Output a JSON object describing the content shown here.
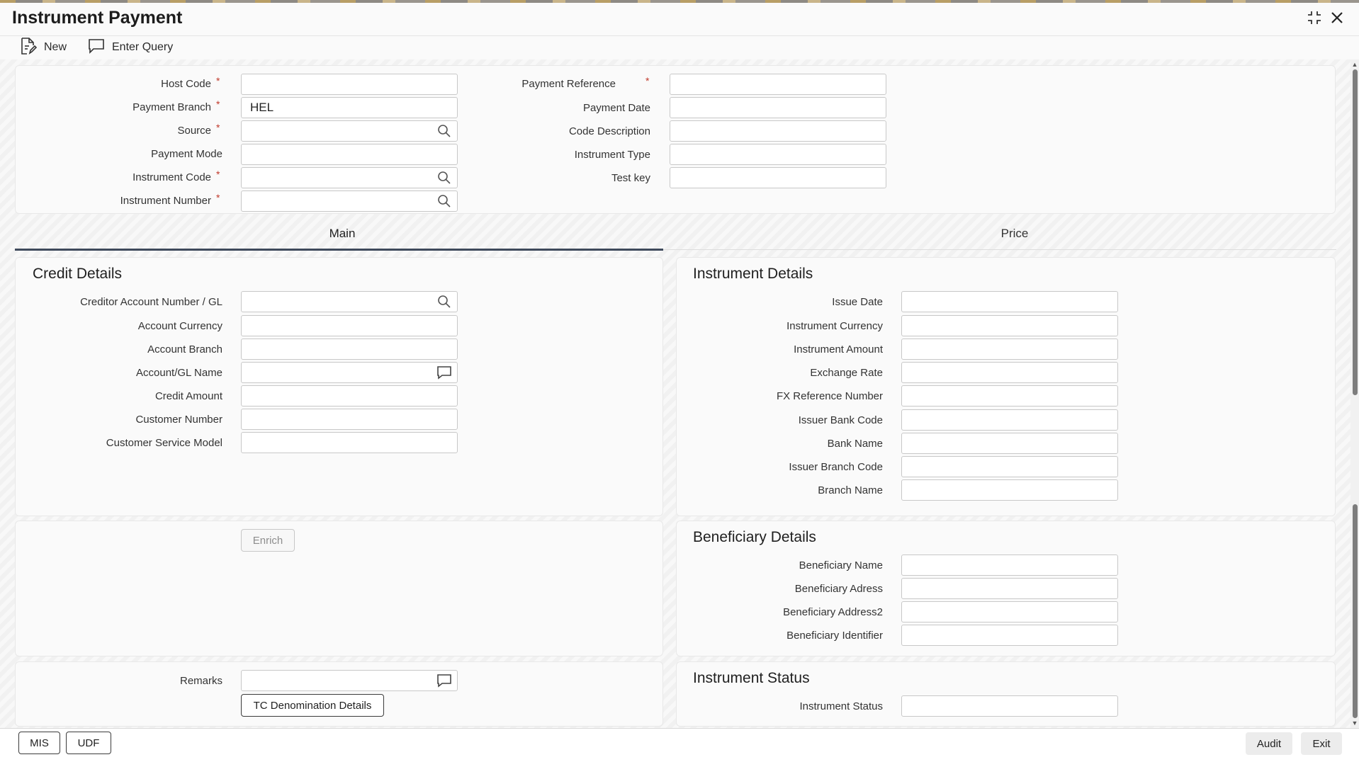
{
  "window": {
    "title": "Instrument Payment",
    "actions": {
      "maximize_icon": "maximize-icon",
      "close_icon": "close-icon"
    }
  },
  "toolbar": {
    "new_label": "New",
    "enter_query_label": "Enter Query"
  },
  "header_form": {
    "host_code": {
      "label": "Host Code",
      "required": "*",
      "value": ""
    },
    "payment_branch": {
      "label": "Payment Branch",
      "required": "*",
      "value": "HEL"
    },
    "source": {
      "label": "Source",
      "required": "*",
      "value": ""
    },
    "payment_mode": {
      "label": "Payment Mode",
      "value": ""
    },
    "instrument_code": {
      "label": "Instrument Code",
      "required": "*",
      "value": ""
    },
    "instrument_number": {
      "label": "Instrument Number",
      "required": "*",
      "value": ""
    },
    "payment_reference": {
      "label": "Payment Reference",
      "required": "*",
      "value": ""
    },
    "payment_date": {
      "label": "Payment Date",
      "value": ""
    },
    "code_description": {
      "label": "Code Description",
      "value": ""
    },
    "instrument_type": {
      "label": "Instrument Type",
      "value": ""
    },
    "test_key": {
      "label": "Test key",
      "value": ""
    }
  },
  "tabs": [
    {
      "label": "Main",
      "active": true
    },
    {
      "label": "Price",
      "active": false
    }
  ],
  "credit_details": {
    "title": "Credit Details",
    "creditor_account": {
      "label": "Creditor Account Number / GL",
      "value": ""
    },
    "account_currency": {
      "label": "Account Currency",
      "value": ""
    },
    "account_branch": {
      "label": "Account Branch",
      "value": ""
    },
    "account_gl_name": {
      "label": "Account/GL Name",
      "value": ""
    },
    "credit_amount": {
      "label": "Credit Amount",
      "value": ""
    },
    "customer_number": {
      "label": "Customer Number",
      "value": ""
    },
    "customer_service_model": {
      "label": "Customer Service Model",
      "value": ""
    }
  },
  "enrich_label": "Enrich",
  "remarks": {
    "label": "Remarks",
    "value": ""
  },
  "tc_denomination_label": "TC Denomination Details",
  "instrument_details": {
    "title": "Instrument Details",
    "issue_date": {
      "label": "Issue Date",
      "value": ""
    },
    "instrument_currency": {
      "label": "Instrument Currency",
      "value": ""
    },
    "instrument_amount": {
      "label": "Instrument Amount",
      "value": ""
    },
    "exchange_rate": {
      "label": "Exchange Rate",
      "value": ""
    },
    "fx_reference_number": {
      "label": "FX Reference Number",
      "value": ""
    },
    "issuer_bank_code": {
      "label": "Issuer Bank Code",
      "value": ""
    },
    "bank_name": {
      "label": "Bank Name",
      "value": ""
    },
    "issuer_branch_code": {
      "label": "Issuer Branch Code",
      "value": ""
    },
    "branch_name": {
      "label": "Branch Name",
      "value": ""
    }
  },
  "beneficiary_details": {
    "title": "Beneficiary Details",
    "beneficiary_name": {
      "label": "Beneficiary Name",
      "value": ""
    },
    "beneficiary_adress": {
      "label": "Beneficiary Adress",
      "value": ""
    },
    "beneficiary_address2": {
      "label": "Beneficiary Address2",
      "value": ""
    },
    "beneficiary_identifier": {
      "label": "Beneficiary Identifier",
      "value": ""
    }
  },
  "instrument_status": {
    "title": "Instrument Status",
    "status": {
      "label": "Instrument Status",
      "value": ""
    }
  },
  "footer": {
    "mis_label": "MIS",
    "udf_label": "UDF",
    "audit_label": "Audit",
    "exit_label": "Exit"
  },
  "colors": {
    "required_marker": "#c0392b",
    "active_tab_underline": "#3f4a5c",
    "field_border": "#c8c8c8",
    "scroll_thumb": "#7d7d7d"
  }
}
